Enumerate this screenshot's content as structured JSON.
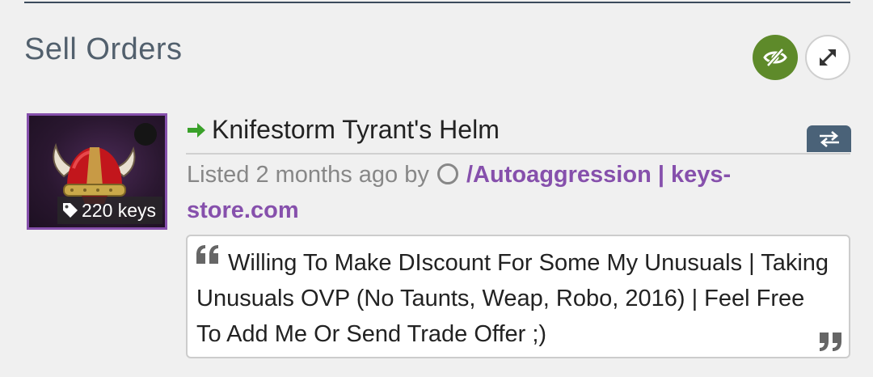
{
  "section": {
    "title": "Sell Orders"
  },
  "controls": {
    "visibility_icon": "eye-slash-icon",
    "expand_icon": "expand-arrows-icon",
    "visibility_color": "#5e8a2a"
  },
  "listing": {
    "item_name": "Knifestorm Tyrant's Helm",
    "direction_icon": "arrow-right-icon",
    "price": "220 keys",
    "listed_prefix": "Listed 2 months ago by",
    "user_status_icon": "circle-outline-icon",
    "user_name": "/Autoaggression | keys-store.com",
    "trade_icon": "exchange-icon",
    "quality_color": "#8650ac",
    "comment": "Willing To Make DIscount For Some My Unusuals | Taking Unusuals OVP (No Taunts, Weap, Robo, 2016) | Feel Free To Add Me Or Send Trade Offer ;)"
  }
}
